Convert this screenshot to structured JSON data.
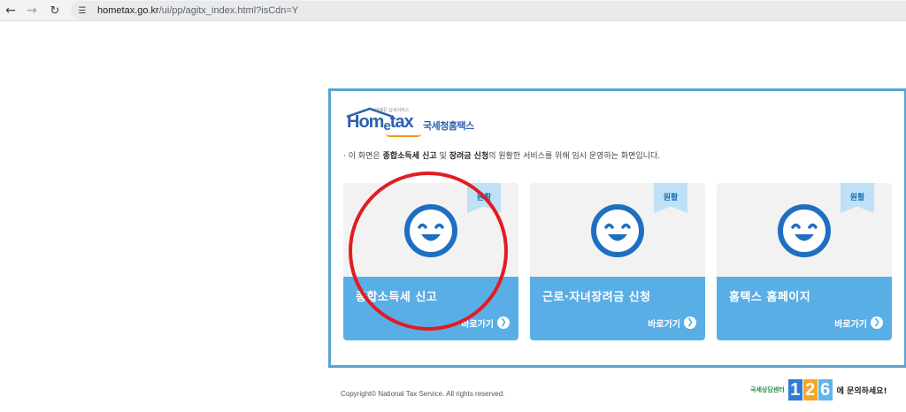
{
  "browser": {
    "url_host": "hometax.go.kr",
    "url_path": "/ui/pp/agitx_index.html?isCdn=Y"
  },
  "logo": {
    "word": "Hom",
    "word_e": "e",
    "word_tail": "tax",
    "small_text": "언제든 납세서비스",
    "korean": "국세청홈택스"
  },
  "notice": {
    "prefix": "· 이 화면은 ",
    "bold1": "종합소득세 신고",
    "mid": " 및 ",
    "bold2": "장려금 신청",
    "suffix": "의 원활한 서비스를 위해 임시 운영하는 화면입니다."
  },
  "cards": [
    {
      "badge": "원활",
      "title": "종합소득세 신고",
      "link": "바로가기"
    },
    {
      "badge": "원활",
      "title": "근로·자녀장려금 신청",
      "link": "바로가기"
    },
    {
      "badge": "원활",
      "title": "홈택스 홈페이지",
      "link": "바로가기"
    }
  ],
  "footer": {
    "copyright": "Copyright© National Tax Service.  All rights reserved.",
    "callcenter_label": "국세상담센터",
    "digits": [
      "1",
      "2",
      "6"
    ],
    "callcenter_tail": "에 문의하세요!"
  },
  "colors": {
    "panel_border": "#5aa4d4",
    "card_bottom": "#5aaee6",
    "face": "#1f6fc1",
    "annotation_ring": "#e31b23"
  }
}
